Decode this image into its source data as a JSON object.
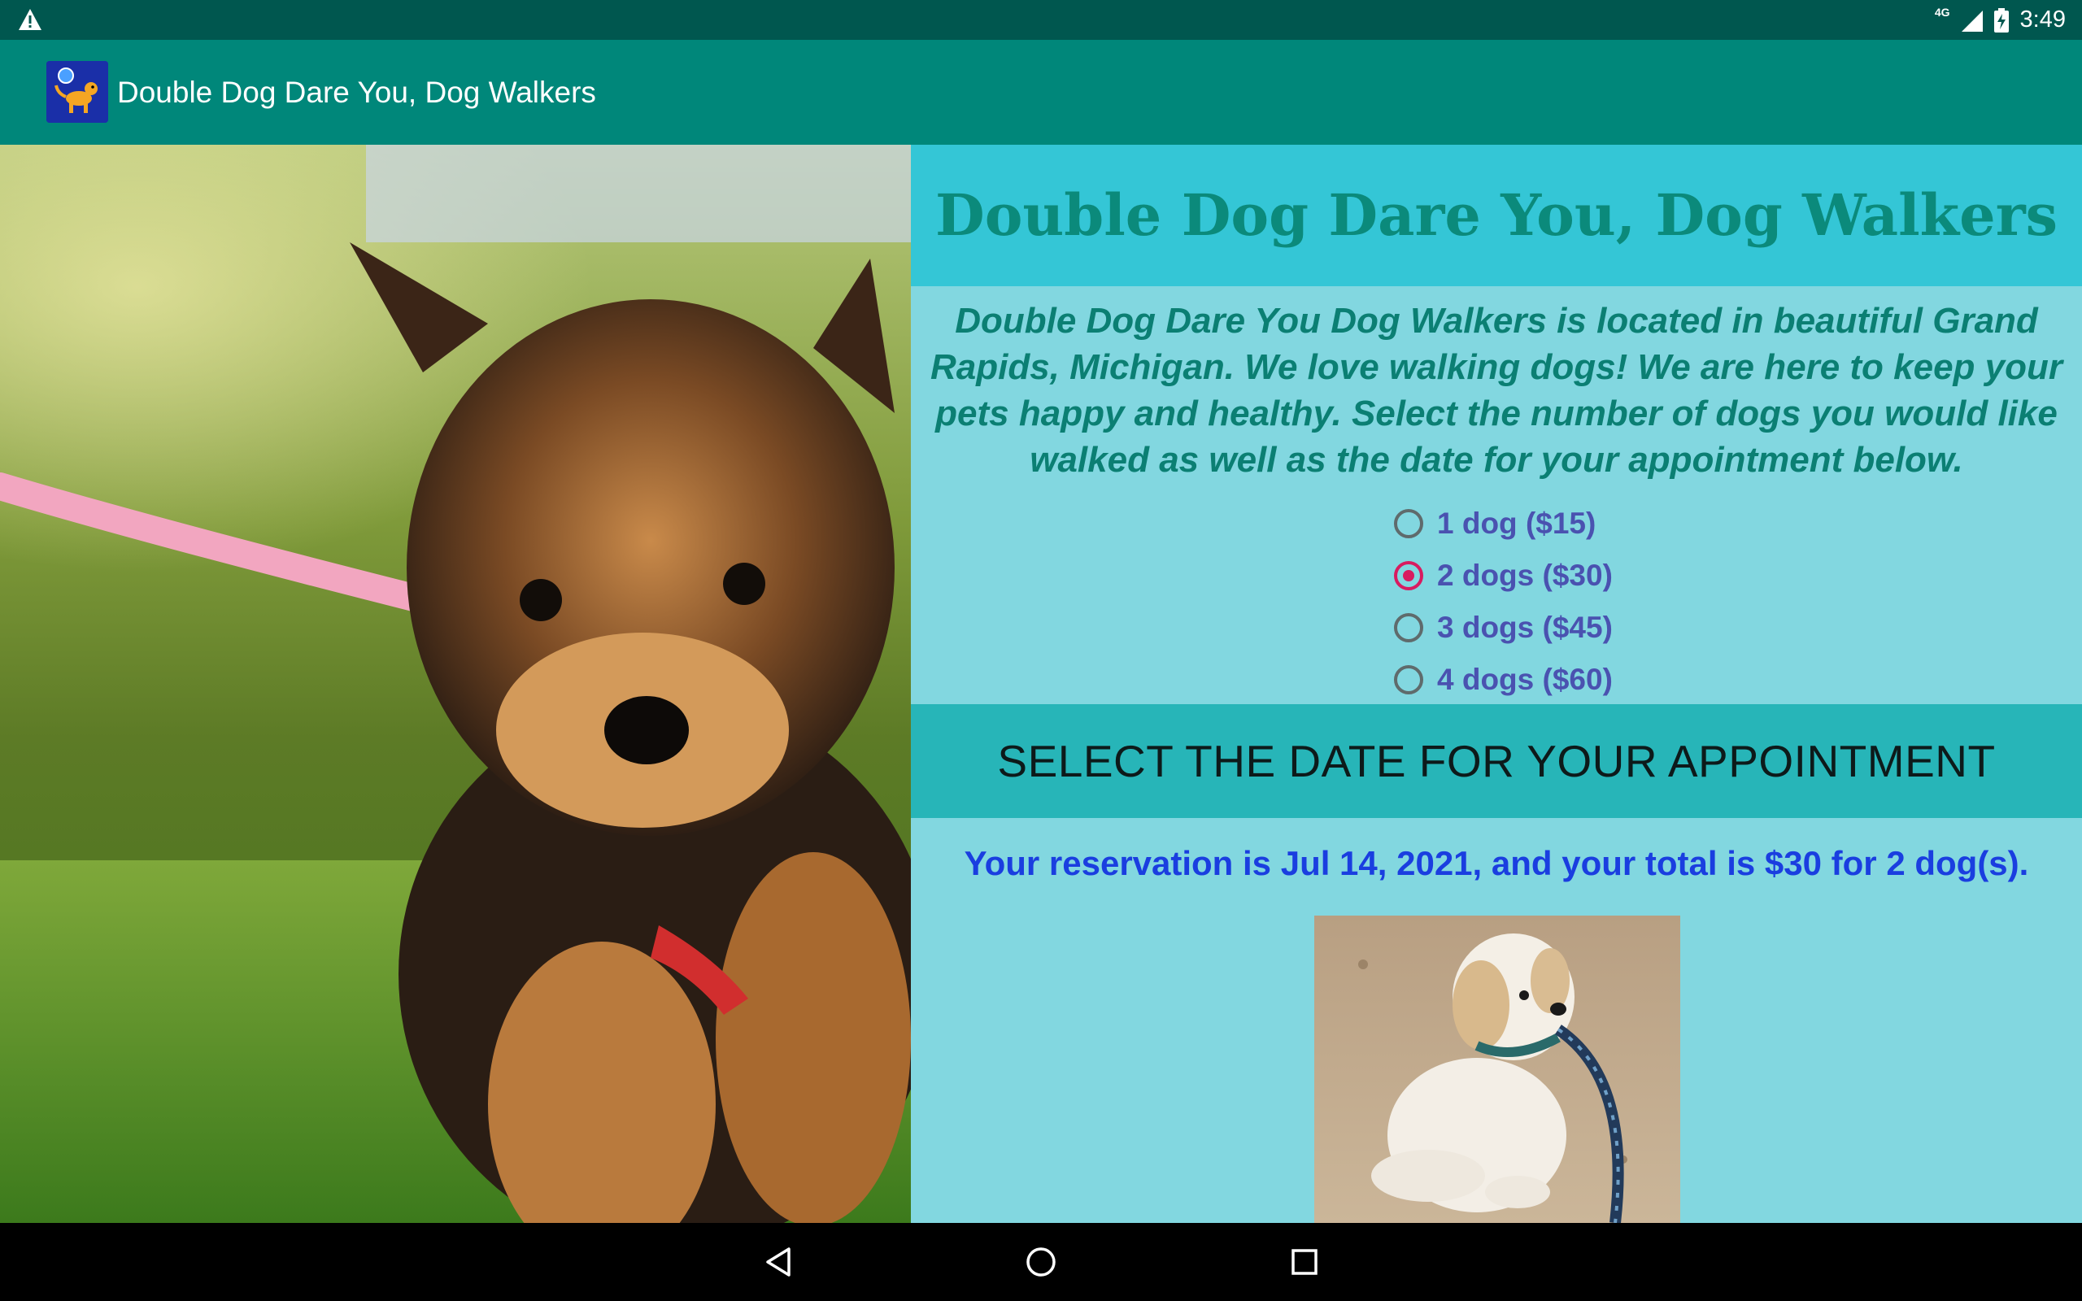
{
  "status_bar": {
    "time": "3:49",
    "network": "4G",
    "icons": [
      "warning-icon",
      "signal-icon",
      "battery-charging-icon"
    ]
  },
  "app_bar": {
    "title": "Double Dog Dare You, Dog Walkers",
    "icon": "dog-logo-icon"
  },
  "main": {
    "heading": "Double Dog Dare You, Dog Walkers",
    "description": "Double Dog Dare You Dog Walkers is located in beautiful Grand Rapids, Michigan. We love walking dogs! We are here to keep your pets happy and healthy. Select the number of dogs you would like walked as well as the date for your appointment below.",
    "options": [
      {
        "label": "1 dog ($15)",
        "checked": false
      },
      {
        "label": "2 dogs ($30)",
        "checked": true
      },
      {
        "label": "3 dogs ($45)",
        "checked": false
      },
      {
        "label": "4 dogs ($60)",
        "checked": false
      }
    ],
    "date_button": "SELECT THE DATE FOR YOUR APPOINTMENT",
    "reservation": "Your reservation is Jul 14, 2021, and your total is $30 for 2 dog(s)."
  },
  "nav_bar": {
    "buttons": [
      "back-icon",
      "home-icon",
      "recents-icon"
    ]
  },
  "colors": {
    "status_bar": "#00574f",
    "app_bar": "#00877a",
    "heading_band": "#34c6d6",
    "content_bg": "#82d7e0",
    "date_button": "#27b5b8",
    "radio_checked": "#d81b60"
  }
}
